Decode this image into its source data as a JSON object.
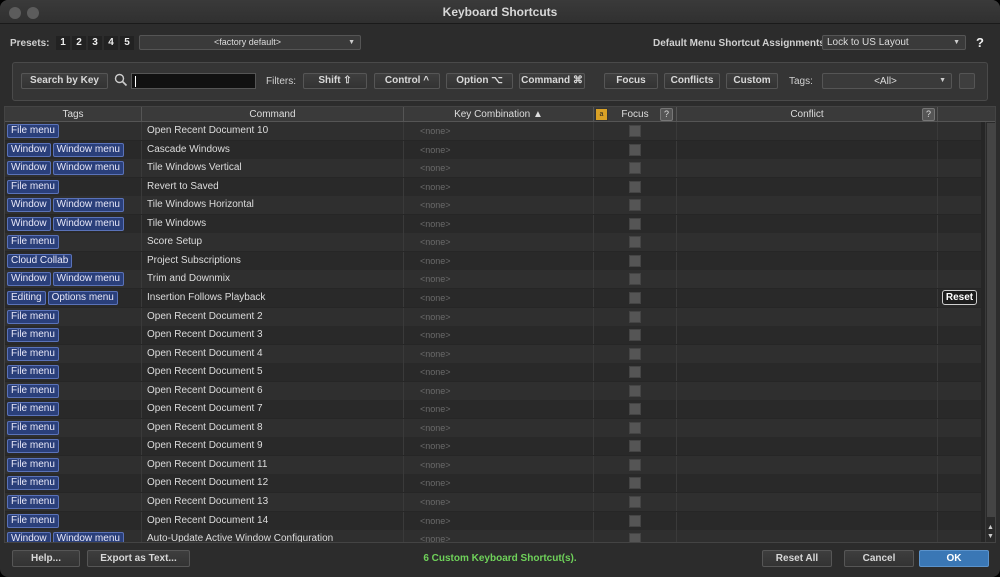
{
  "window": {
    "title": "Keyboard Shortcuts"
  },
  "presets": {
    "label": "Presets:",
    "numbers": [
      "1",
      "2",
      "3",
      "4",
      "5"
    ],
    "selected": "<factory default>"
  },
  "assignments": {
    "label": "Default Menu Shortcut Assignments:",
    "selected": "Lock to US Layout",
    "help": "?"
  },
  "filterbar": {
    "search_button": "Search by Key",
    "search_value": "",
    "filters_label": "Filters:",
    "filters": [
      "Shift ⇧",
      "Control ^",
      "Option ⌥",
      "Command ⌘"
    ],
    "focus": "Focus",
    "conflicts": "Conflicts",
    "custom": "Custom",
    "tags_label": "Tags:",
    "tags_selected": "<All>"
  },
  "table": {
    "headers": {
      "tags": "Tags",
      "command": "Command",
      "key": "Key Combination ▲",
      "focus": "Focus",
      "focus_help": "?",
      "conflict": "Conflict",
      "conflict_help": "?"
    },
    "none_text": "<none>",
    "reset_label": "Reset",
    "rows": [
      {
        "tags": [
          "File menu"
        ],
        "command": "Open Recent Document 10",
        "reset": false
      },
      {
        "tags": [
          "Window",
          "Window menu"
        ],
        "command": "Cascade Windows",
        "reset": false
      },
      {
        "tags": [
          "Window",
          "Window menu"
        ],
        "command": "Tile Windows Vertical",
        "reset": false
      },
      {
        "tags": [
          "File menu"
        ],
        "command": "Revert to Saved",
        "reset": false
      },
      {
        "tags": [
          "Window",
          "Window menu"
        ],
        "command": "Tile Windows Horizontal",
        "reset": false
      },
      {
        "tags": [
          "Window",
          "Window menu"
        ],
        "command": "Tile Windows",
        "reset": false
      },
      {
        "tags": [
          "File menu"
        ],
        "command": "Score Setup",
        "reset": false
      },
      {
        "tags": [
          "Cloud Collab"
        ],
        "command": "Project Subscriptions",
        "reset": false
      },
      {
        "tags": [
          "Window",
          "Window menu"
        ],
        "command": "Trim and Downmix",
        "reset": false
      },
      {
        "tags": [
          "Editing",
          "Options menu"
        ],
        "command": "Insertion Follows Playback",
        "reset": true
      },
      {
        "tags": [
          "File menu"
        ],
        "command": "Open Recent Document 2",
        "reset": false
      },
      {
        "tags": [
          "File menu"
        ],
        "command": "Open Recent Document 3",
        "reset": false
      },
      {
        "tags": [
          "File menu"
        ],
        "command": "Open Recent Document 4",
        "reset": false
      },
      {
        "tags": [
          "File menu"
        ],
        "command": "Open Recent Document 5",
        "reset": false
      },
      {
        "tags": [
          "File menu"
        ],
        "command": "Open Recent Document 6",
        "reset": false
      },
      {
        "tags": [
          "File menu"
        ],
        "command": "Open Recent Document 7",
        "reset": false
      },
      {
        "tags": [
          "File menu"
        ],
        "command": "Open Recent Document 8",
        "reset": false
      },
      {
        "tags": [
          "File menu"
        ],
        "command": "Open Recent Document 9",
        "reset": false
      },
      {
        "tags": [
          "File menu"
        ],
        "command": "Open Recent Document 11",
        "reset": false
      },
      {
        "tags": [
          "File menu"
        ],
        "command": "Open Recent Document 12",
        "reset": false
      },
      {
        "tags": [
          "File menu"
        ],
        "command": "Open Recent Document 13",
        "reset": false
      },
      {
        "tags": [
          "File menu"
        ],
        "command": "Open Recent Document 14",
        "reset": false
      },
      {
        "tags": [
          "Window",
          "Window menu"
        ],
        "command": "Auto-Update Active Window Configuration",
        "reset": false
      }
    ]
  },
  "footer": {
    "help": "Help...",
    "export": "Export as Text...",
    "status": "6 Custom Keyboard Shortcut(s).",
    "reset_all": "Reset All",
    "cancel": "Cancel",
    "ok": "OK"
  },
  "colors": {
    "tag_bg": "#2a3f7a",
    "status": "#6fd25a",
    "ok": "#3a77b5"
  }
}
